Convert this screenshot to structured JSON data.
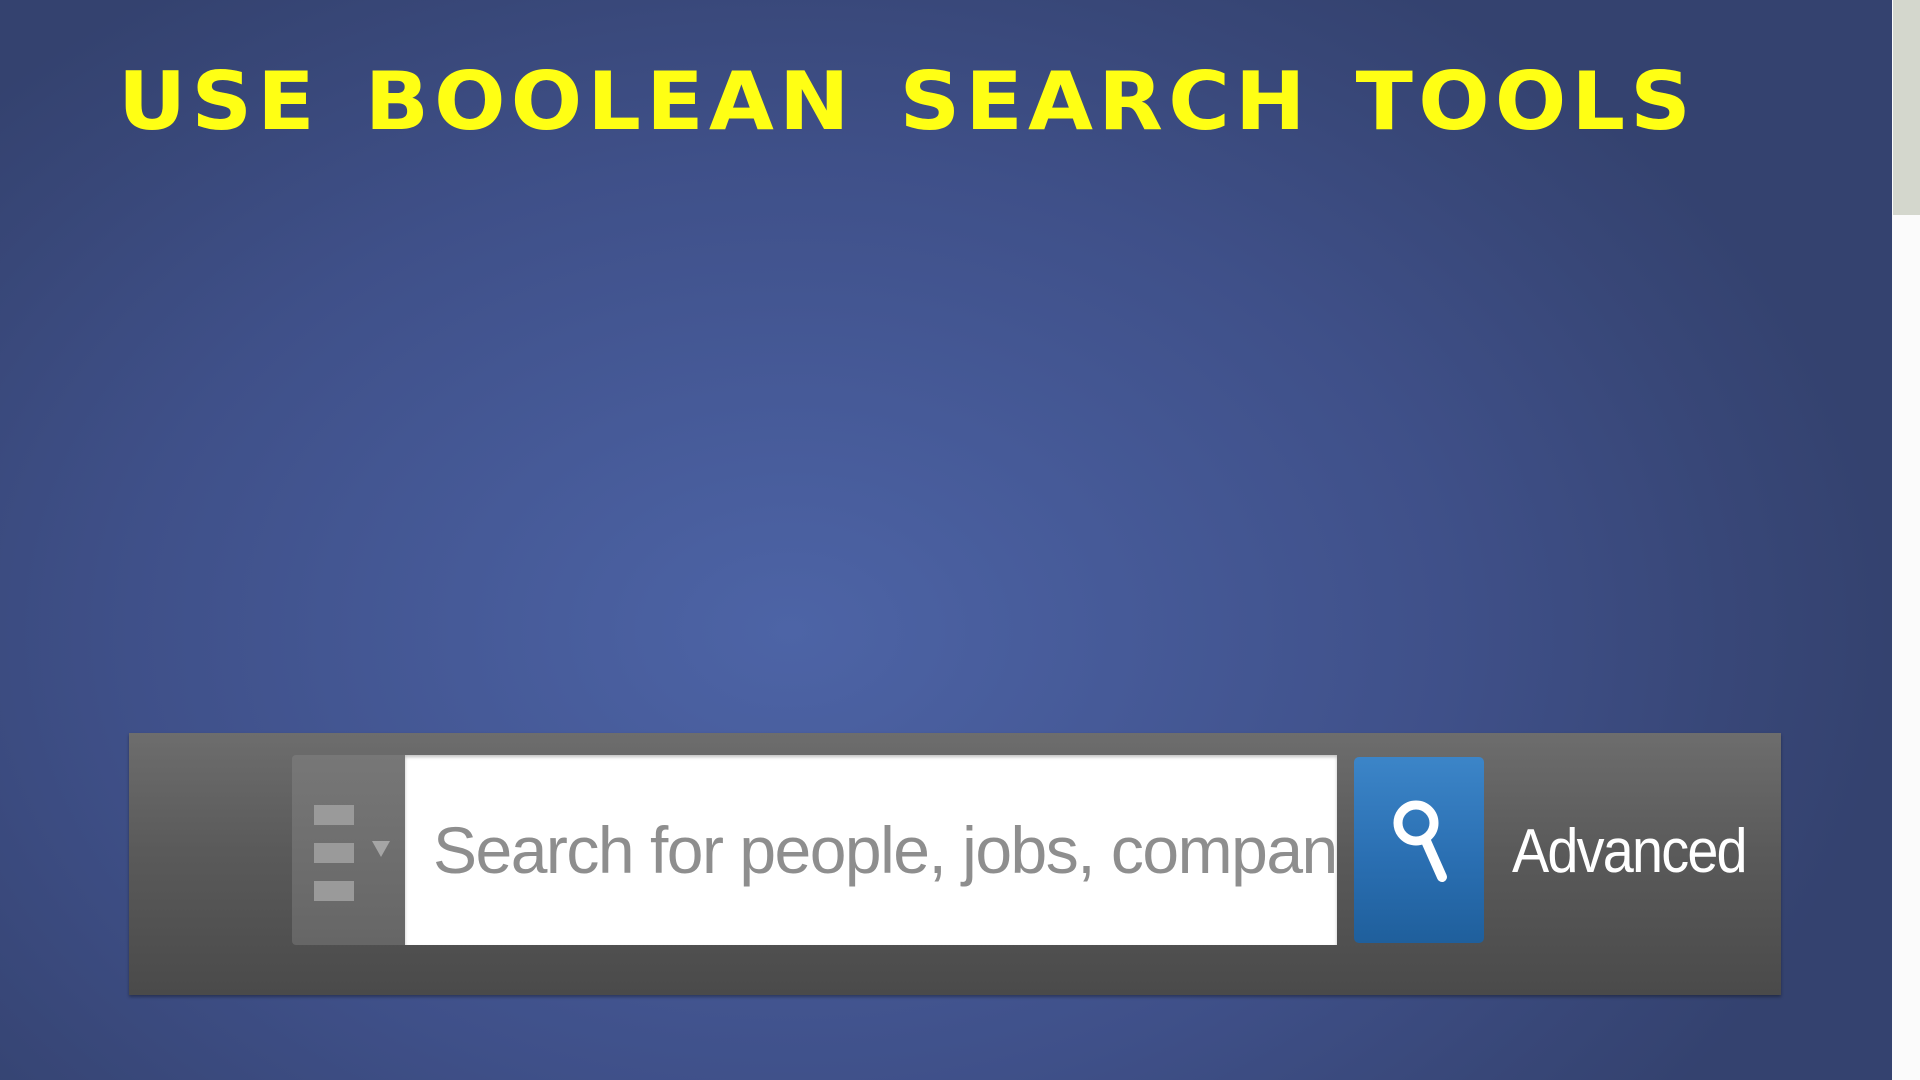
{
  "slide": {
    "title": "USE BOOLEAN SEARCH TOOLS",
    "title_color": "#ffff14",
    "background_color": "#4d64a6"
  },
  "search": {
    "filter_icon": "list-icon",
    "dropdown_icon": "chevron-down-icon",
    "placeholder": "Search for people, jobs, companies, and more...",
    "value": "",
    "button_icon": "search-icon",
    "button_color": "#2a6fb2",
    "advanced_label": "Advanced"
  }
}
